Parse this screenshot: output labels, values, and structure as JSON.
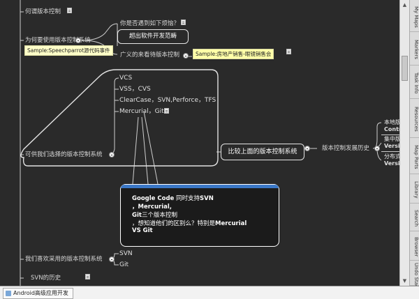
{
  "nodes": {
    "what_is_vc": "何谓版本控制",
    "why_use_vc": "为何要使用版本控制系统",
    "sample_speechparrot": "Sample:Speechparrot源代码事件",
    "have_you_met": "你是否遇到如下烦恼？",
    "beyond_scope": "超出软件开发范畴",
    "broad_meaning": "广义的来看待版本控制",
    "sample_realestate": "Sample:房地产销售-眼镜销售会",
    "vcs": "VCS",
    "vss_cvs": "VSS，CVS",
    "clearcase": "ClearCase，SVN,Perforce，TFS",
    "mercurial_git": "Mercurial，Git",
    "available_vcs": "可供我们选择的版本控制系统",
    "compare": "比较上面的版本控制系统",
    "evolution": "版本控制发展历史",
    "local_vc": "本地版",
    "local_vc_2": "Contr",
    "central_vc": "集中版",
    "central_vc_2": "Versic",
    "distributed_vc": "分布式",
    "distributed_vc_2": "Versic",
    "we_like": "我们喜欢采用的版本控制系统",
    "svn": "SVN",
    "git": "Git",
    "svn_history": "SVN的历史"
  },
  "popup": {
    "line1_a": "Google Code",
    "line1_b": " 同时支持",
    "line1_c": "SVN",
    "line2": "，Mercurial,",
    "line3_a": "Git",
    "line3_b": "三个版本控制",
    "line4_a": "，想知道他们的区别么？特别是",
    "line4_b": "Mercurial",
    "line5": "VS Git"
  },
  "side_tabs": [
    "My Maps",
    "Markers",
    "Task Info",
    "Resources",
    "Map Parts",
    "Library",
    "Search",
    "Browser",
    "Undo Stack"
  ],
  "taskbar": {
    "app": "Android高级应用开发"
  },
  "colors": {
    "background": "#2a2a2a",
    "tag": "#ffffc8",
    "popup_bar": "#3b78c7"
  }
}
